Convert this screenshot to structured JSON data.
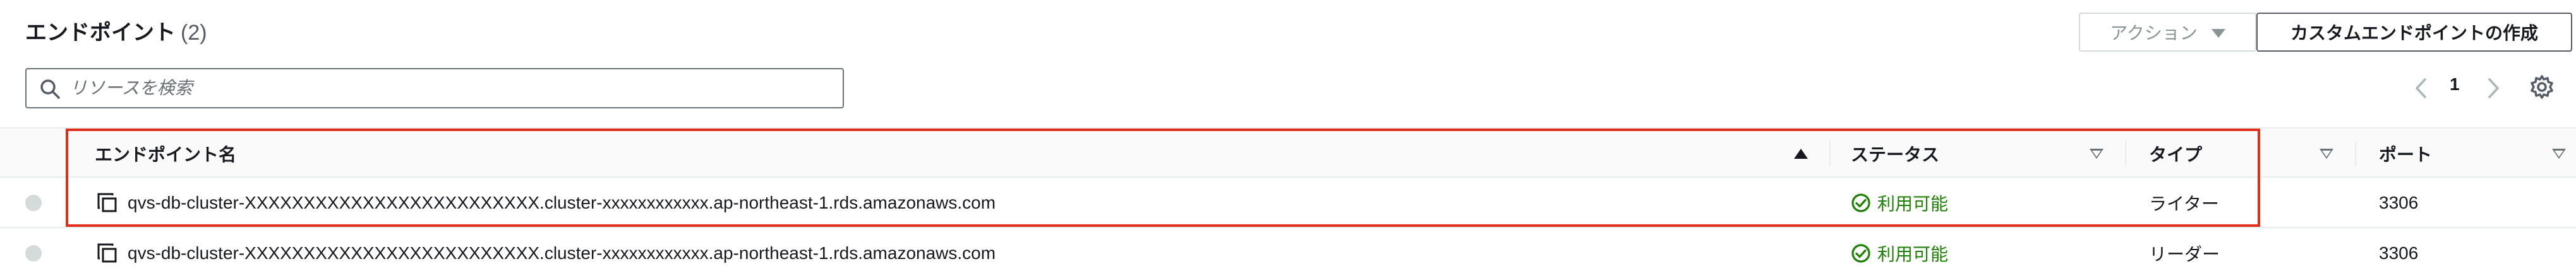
{
  "header": {
    "title": "エンドポイント",
    "count": "(2)"
  },
  "toolbar": {
    "action_label": "アクション",
    "create_label": "カスタムエンドポイントの作成"
  },
  "search": {
    "placeholder": "リソースを検索"
  },
  "pagination": {
    "current_page": "1"
  },
  "table": {
    "columns": [
      {
        "label": "エンドポイント名",
        "sort": "ascending"
      },
      {
        "label": "ステータス",
        "sort": "none"
      },
      {
        "label": "タイプ",
        "sort": "none"
      },
      {
        "label": "ポート",
        "sort": "none"
      }
    ],
    "rows": [
      {
        "endpoint": "qvs-db-cluster-XXXXXXXXXXXXXXXXXXXXXXXXX.cluster-xxxxxxxxxxxx.ap-northeast-1.rds.amazonaws.com",
        "status": "利用可能",
        "type": "ライター",
        "port": "3306"
      },
      {
        "endpoint": "qvs-db-cluster-XXXXXXXXXXXXXXXXXXXXXXXXX.cluster-xxxxxxxxxxxx.ap-northeast-1.rds.amazonaws.com",
        "status": "利用可能",
        "type": "リーダー",
        "port": "3306"
      }
    ]
  },
  "colors": {
    "status_available": "#1d8102",
    "highlight_border": "#e22d1b",
    "text_primary": "#16191f",
    "text_secondary": "#545b64"
  },
  "icons": [
    "search-icon",
    "chevron-left-icon",
    "chevron-right-icon",
    "gear-icon",
    "copy-icon",
    "status-ok-icon",
    "sort-ascending-icon",
    "sort-descending-icon"
  ]
}
